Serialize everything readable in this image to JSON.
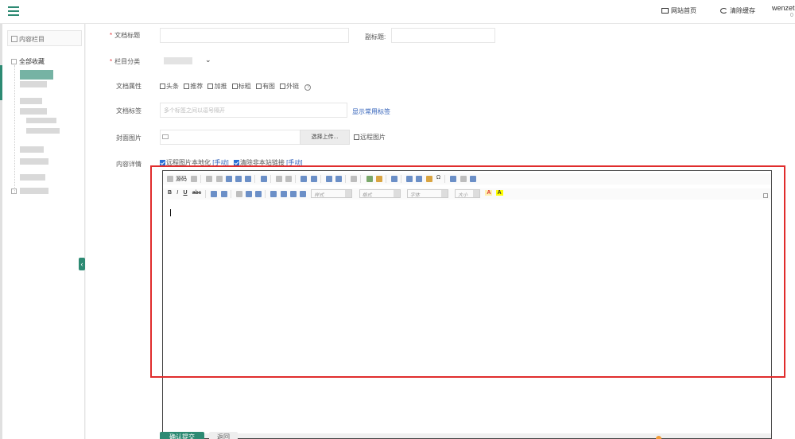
{
  "header": {
    "site_home": "网站首页",
    "clear_cache": "清除缓存",
    "username": "wenzet",
    "username_sub": "0"
  },
  "sidebar": {
    "title": "内容栏目",
    "tree_root": "全部收藏"
  },
  "form": {
    "title_label": "文档标题",
    "subtitle_label": "副标题:",
    "category_label": "栏目分类",
    "attr_label": "文档属性",
    "attrs": [
      "头条",
      "推荐",
      "加推",
      "标粗",
      "有图",
      "外链"
    ],
    "tags_label": "文档标签",
    "tags_placeholder": "多个标签之间以逗号隔开",
    "show_tags_link": "显示常用标签",
    "cover_label": "封面图片",
    "upload_button": "选择上传...",
    "remote_image": "远程图片",
    "content_label": "内容详情",
    "localize_images": "远程图片本地化",
    "manual_1": "[手动]",
    "strip_links": "清除非本站链接",
    "manual_2": "[手动]"
  },
  "editor": {
    "source_label": "源码",
    "bold": "B",
    "italic": "I",
    "underline": "U",
    "strike": "abc",
    "style_dd": "样式",
    "format_dd": "格式",
    "font_dd": "字体",
    "size_dd": "大小",
    "font_color": "A",
    "bg_color": "A"
  },
  "actions": {
    "submit": "确认提交",
    "back": "返回"
  },
  "colors": {
    "brand": "#2d8a73",
    "highlight_box": "#e02c2c",
    "link": "#2f5fb8"
  }
}
